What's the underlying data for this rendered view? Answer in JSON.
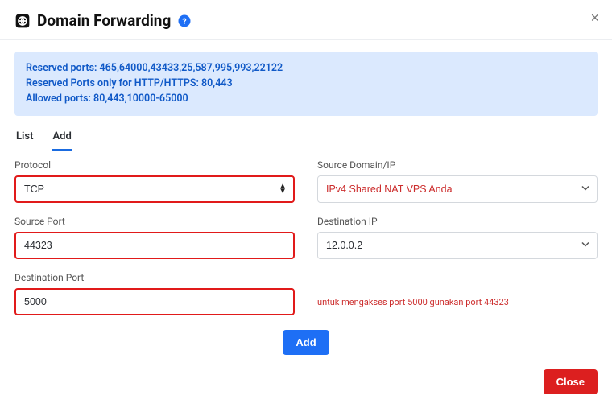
{
  "header": {
    "title": "Domain Forwarding",
    "help_icon": "help-icon",
    "close_label": "×"
  },
  "info": {
    "line1": "Reserved ports: 465,64000,43433,25,587,995,993,22122",
    "line2": "Reserved Ports only for HTTP/HTTPS: 80,443",
    "line3": "Allowed ports: 80,443,10000-65000"
  },
  "tabs": {
    "list": "List",
    "add": "Add",
    "active": "add"
  },
  "form": {
    "protocol_label": "Protocol",
    "protocol_value": "TCP",
    "source_domain_label": "Source Domain/IP",
    "source_domain_value": "IPv4 Shared NAT VPS Anda",
    "source_port_label": "Source Port",
    "source_port_value": "44323",
    "destination_ip_label": "Destination IP",
    "destination_ip_value": "12.0.0.2",
    "destination_port_label": "Destination Port",
    "destination_port_value": "5000",
    "note": "untuk mengakses port 5000 gunakan port 44323"
  },
  "buttons": {
    "add": "Add",
    "close": "Close"
  },
  "colors": {
    "info_bg": "#dbe9fe",
    "info_text": "#1059c7",
    "primary": "#1e6ff5",
    "danger": "#dc1f1f",
    "hilite": "#e11a1a"
  }
}
